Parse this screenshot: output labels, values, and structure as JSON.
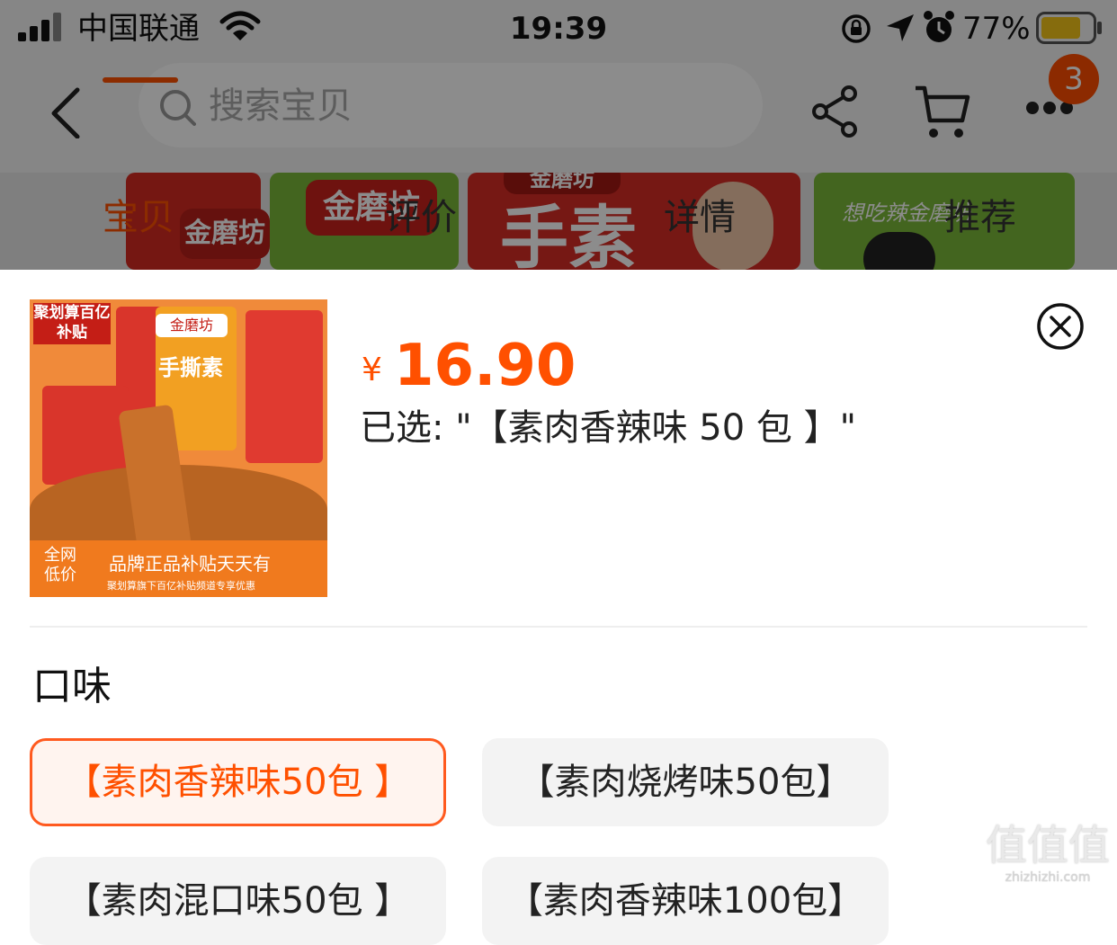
{
  "status_bar": {
    "carrier": "中国联通",
    "time": "19:39",
    "battery": "77%"
  },
  "nav": {
    "search_placeholder": "搜索宝贝",
    "cart_badge": "3"
  },
  "tabs": [
    {
      "label": "宝贝",
      "active": true
    },
    {
      "label": "评价",
      "active": false
    },
    {
      "label": "详情",
      "active": false
    },
    {
      "label": "推荐",
      "active": false
    }
  ],
  "hero_images": {
    "logo_text": "金磨坊",
    "big_text": "手素",
    "script_text": "想吃辣金磨坊"
  },
  "product": {
    "thumb_badge": "聚划算百亿补贴",
    "thumb_brand": "金磨坊",
    "thumb_title": "手撕素",
    "thumb_corner": "全网低价",
    "thumb_banner": "品牌正品补贴天天有",
    "thumb_sub": "聚划算旗下百亿补贴频道专享优惠",
    "currency": "¥",
    "price": "16.90",
    "selected_text": "已选: \"【素肉香辣味 50 包 】\""
  },
  "section": {
    "title": "口味"
  },
  "options": [
    {
      "label": "【素肉香辣味50包 】",
      "selected": true
    },
    {
      "label": "【素肉烧烤味50包】",
      "selected": false
    },
    {
      "label": "【素肉混口味50包 】",
      "selected": false
    },
    {
      "label": "【素肉香辣味100包】",
      "selected": false
    }
  ],
  "watermark": {
    "big": "值值值",
    "small": "zhizhizhi.com"
  },
  "colors": {
    "accent": "#ff5000",
    "option_bg": "#f3f3f3",
    "selected_border": "#ff5a1f"
  }
}
